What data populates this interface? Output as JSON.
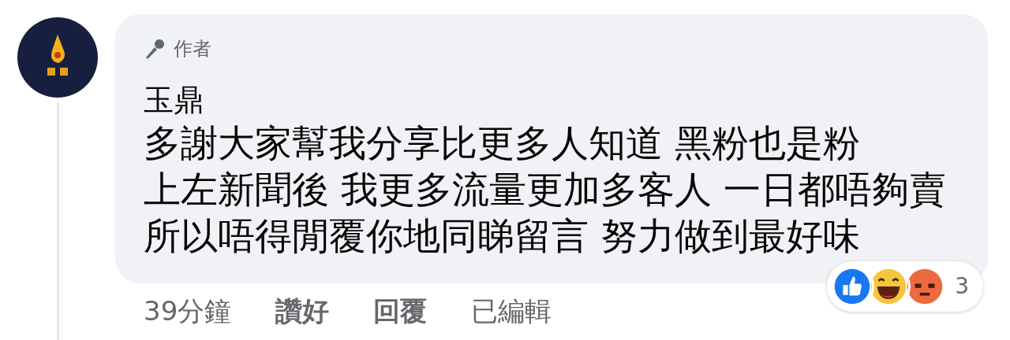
{
  "comment": {
    "badge": "作者",
    "author": "玉鼎",
    "lines": [
      "多謝大家幫我分享比更多人知道 黑粉也是粉",
      "上左新聞後 我更多流量更加多客人 一日都唔夠賣",
      "所以唔得閒覆你地同睇留言 努力做到最好味"
    ],
    "reactions": [
      {
        "kind": "like"
      },
      {
        "kind": "haha"
      },
      {
        "kind": "angry"
      }
    ],
    "reaction_count": "3",
    "actions": [
      {
        "kind": "time",
        "label": "39分鐘"
      },
      {
        "kind": "link",
        "label": "讚好"
      },
      {
        "kind": "link",
        "label": "回覆"
      },
      {
        "kind": "time",
        "label": "已編輯"
      }
    ]
  }
}
